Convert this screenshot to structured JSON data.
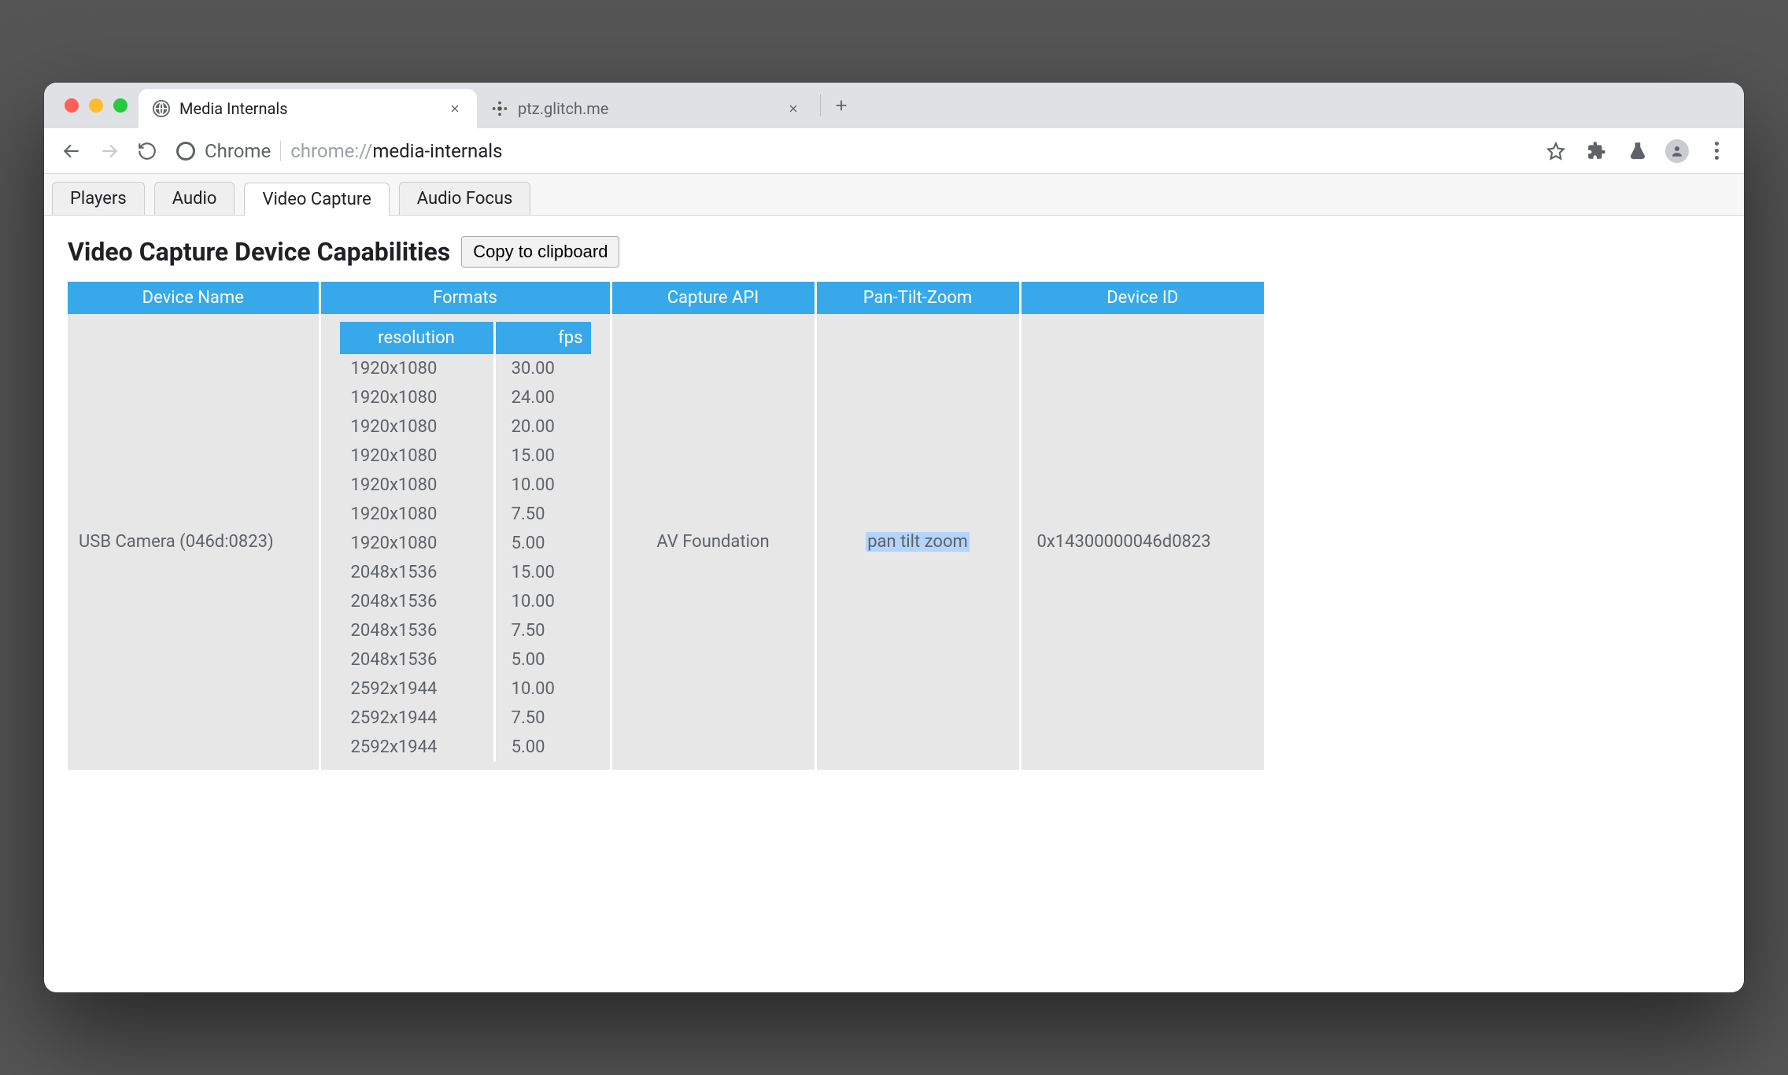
{
  "browser": {
    "tabs": [
      {
        "title": "Media Internals",
        "active": true
      },
      {
        "title": "ptz.glitch.me",
        "active": false
      }
    ],
    "omnibox": {
      "origin_label": "Chrome",
      "scheme": "chrome://",
      "path": "media-internals"
    }
  },
  "page": {
    "subtabs": [
      "Players",
      "Audio",
      "Video Capture",
      "Audio Focus"
    ],
    "active_subtab": "Video Capture",
    "heading": "Video Capture Device Capabilities",
    "copy_label": "Copy to clipboard",
    "table": {
      "headers": [
        "Device Name",
        "Formats",
        "Capture API",
        "Pan-Tilt-Zoom",
        "Device ID"
      ],
      "format_headers": {
        "res": "resolution",
        "fps": "fps"
      },
      "row": {
        "device_name": "USB Camera (046d:0823)",
        "capture_api": "AV Foundation",
        "ptz": "pan tilt zoom",
        "device_id": "0x14300000046d0823",
        "formats": [
          {
            "res": "1920x1080",
            "fps": "30.00"
          },
          {
            "res": "1920x1080",
            "fps": "24.00"
          },
          {
            "res": "1920x1080",
            "fps": "20.00"
          },
          {
            "res": "1920x1080",
            "fps": "15.00"
          },
          {
            "res": "1920x1080",
            "fps": "10.00"
          },
          {
            "res": "1920x1080",
            "fps": "7.50"
          },
          {
            "res": "1920x1080",
            "fps": "5.00"
          },
          {
            "res": "2048x1536",
            "fps": "15.00"
          },
          {
            "res": "2048x1536",
            "fps": "10.00"
          },
          {
            "res": "2048x1536",
            "fps": "7.50"
          },
          {
            "res": "2048x1536",
            "fps": "5.00"
          },
          {
            "res": "2592x1944",
            "fps": "10.00"
          },
          {
            "res": "2592x1944",
            "fps": "7.50"
          },
          {
            "res": "2592x1944",
            "fps": "5.00"
          }
        ]
      }
    }
  }
}
